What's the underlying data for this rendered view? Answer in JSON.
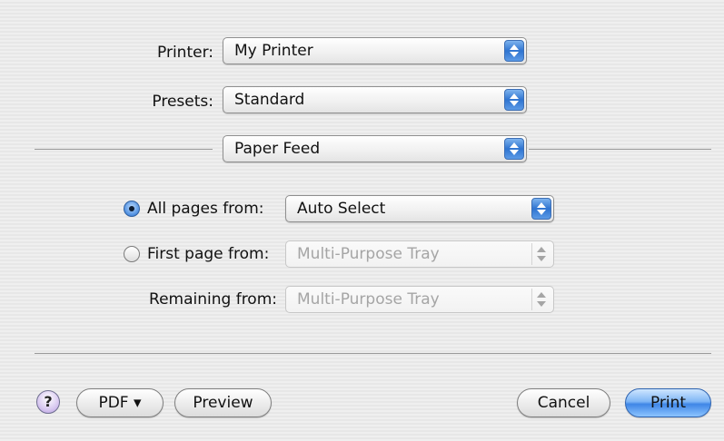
{
  "printer": {
    "label": "Printer:",
    "value": "My Printer"
  },
  "presets": {
    "label": "Presets:",
    "value": "Standard"
  },
  "panel": {
    "value": "Paper Feed"
  },
  "paper_feed": {
    "all_pages": {
      "label": "All pages from:",
      "value": "Auto Select",
      "selected": true
    },
    "first_page": {
      "label": "First page from:",
      "value": "Multi-Purpose Tray",
      "selected": false,
      "enabled": false
    },
    "remaining": {
      "label": "Remaining from:",
      "value": "Multi-Purpose Tray",
      "enabled": false
    }
  },
  "footer": {
    "help_label": "?",
    "pdf_label": "PDF ▾",
    "preview_label": "Preview",
    "cancel_label": "Cancel",
    "print_label": "Print"
  }
}
